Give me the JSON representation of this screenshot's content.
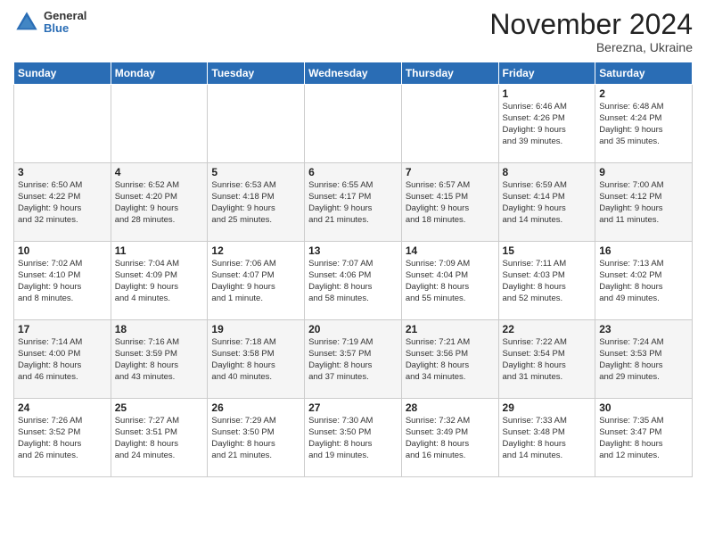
{
  "header": {
    "logo_general": "General",
    "logo_blue": "Blue",
    "month_title": "November 2024",
    "location": "Berezna, Ukraine"
  },
  "weekdays": [
    "Sunday",
    "Monday",
    "Tuesday",
    "Wednesday",
    "Thursday",
    "Friday",
    "Saturday"
  ],
  "weeks": [
    [
      {
        "day": "",
        "info": ""
      },
      {
        "day": "",
        "info": ""
      },
      {
        "day": "",
        "info": ""
      },
      {
        "day": "",
        "info": ""
      },
      {
        "day": "",
        "info": ""
      },
      {
        "day": "1",
        "info": "Sunrise: 6:46 AM\nSunset: 4:26 PM\nDaylight: 9 hours\nand 39 minutes."
      },
      {
        "day": "2",
        "info": "Sunrise: 6:48 AM\nSunset: 4:24 PM\nDaylight: 9 hours\nand 35 minutes."
      }
    ],
    [
      {
        "day": "3",
        "info": "Sunrise: 6:50 AM\nSunset: 4:22 PM\nDaylight: 9 hours\nand 32 minutes."
      },
      {
        "day": "4",
        "info": "Sunrise: 6:52 AM\nSunset: 4:20 PM\nDaylight: 9 hours\nand 28 minutes."
      },
      {
        "day": "5",
        "info": "Sunrise: 6:53 AM\nSunset: 4:18 PM\nDaylight: 9 hours\nand 25 minutes."
      },
      {
        "day": "6",
        "info": "Sunrise: 6:55 AM\nSunset: 4:17 PM\nDaylight: 9 hours\nand 21 minutes."
      },
      {
        "day": "7",
        "info": "Sunrise: 6:57 AM\nSunset: 4:15 PM\nDaylight: 9 hours\nand 18 minutes."
      },
      {
        "day": "8",
        "info": "Sunrise: 6:59 AM\nSunset: 4:14 PM\nDaylight: 9 hours\nand 14 minutes."
      },
      {
        "day": "9",
        "info": "Sunrise: 7:00 AM\nSunset: 4:12 PM\nDaylight: 9 hours\nand 11 minutes."
      }
    ],
    [
      {
        "day": "10",
        "info": "Sunrise: 7:02 AM\nSunset: 4:10 PM\nDaylight: 9 hours\nand 8 minutes."
      },
      {
        "day": "11",
        "info": "Sunrise: 7:04 AM\nSunset: 4:09 PM\nDaylight: 9 hours\nand 4 minutes."
      },
      {
        "day": "12",
        "info": "Sunrise: 7:06 AM\nSunset: 4:07 PM\nDaylight: 9 hours\nand 1 minute."
      },
      {
        "day": "13",
        "info": "Sunrise: 7:07 AM\nSunset: 4:06 PM\nDaylight: 8 hours\nand 58 minutes."
      },
      {
        "day": "14",
        "info": "Sunrise: 7:09 AM\nSunset: 4:04 PM\nDaylight: 8 hours\nand 55 minutes."
      },
      {
        "day": "15",
        "info": "Sunrise: 7:11 AM\nSunset: 4:03 PM\nDaylight: 8 hours\nand 52 minutes."
      },
      {
        "day": "16",
        "info": "Sunrise: 7:13 AM\nSunset: 4:02 PM\nDaylight: 8 hours\nand 49 minutes."
      }
    ],
    [
      {
        "day": "17",
        "info": "Sunrise: 7:14 AM\nSunset: 4:00 PM\nDaylight: 8 hours\nand 46 minutes."
      },
      {
        "day": "18",
        "info": "Sunrise: 7:16 AM\nSunset: 3:59 PM\nDaylight: 8 hours\nand 43 minutes."
      },
      {
        "day": "19",
        "info": "Sunrise: 7:18 AM\nSunset: 3:58 PM\nDaylight: 8 hours\nand 40 minutes."
      },
      {
        "day": "20",
        "info": "Sunrise: 7:19 AM\nSunset: 3:57 PM\nDaylight: 8 hours\nand 37 minutes."
      },
      {
        "day": "21",
        "info": "Sunrise: 7:21 AM\nSunset: 3:56 PM\nDaylight: 8 hours\nand 34 minutes."
      },
      {
        "day": "22",
        "info": "Sunrise: 7:22 AM\nSunset: 3:54 PM\nDaylight: 8 hours\nand 31 minutes."
      },
      {
        "day": "23",
        "info": "Sunrise: 7:24 AM\nSunset: 3:53 PM\nDaylight: 8 hours\nand 29 minutes."
      }
    ],
    [
      {
        "day": "24",
        "info": "Sunrise: 7:26 AM\nSunset: 3:52 PM\nDaylight: 8 hours\nand 26 minutes."
      },
      {
        "day": "25",
        "info": "Sunrise: 7:27 AM\nSunset: 3:51 PM\nDaylight: 8 hours\nand 24 minutes."
      },
      {
        "day": "26",
        "info": "Sunrise: 7:29 AM\nSunset: 3:50 PM\nDaylight: 8 hours\nand 21 minutes."
      },
      {
        "day": "27",
        "info": "Sunrise: 7:30 AM\nSunset: 3:50 PM\nDaylight: 8 hours\nand 19 minutes."
      },
      {
        "day": "28",
        "info": "Sunrise: 7:32 AM\nSunset: 3:49 PM\nDaylight: 8 hours\nand 16 minutes."
      },
      {
        "day": "29",
        "info": "Sunrise: 7:33 AM\nSunset: 3:48 PM\nDaylight: 8 hours\nand 14 minutes."
      },
      {
        "day": "30",
        "info": "Sunrise: 7:35 AM\nSunset: 3:47 PM\nDaylight: 8 hours\nand 12 minutes."
      }
    ]
  ]
}
